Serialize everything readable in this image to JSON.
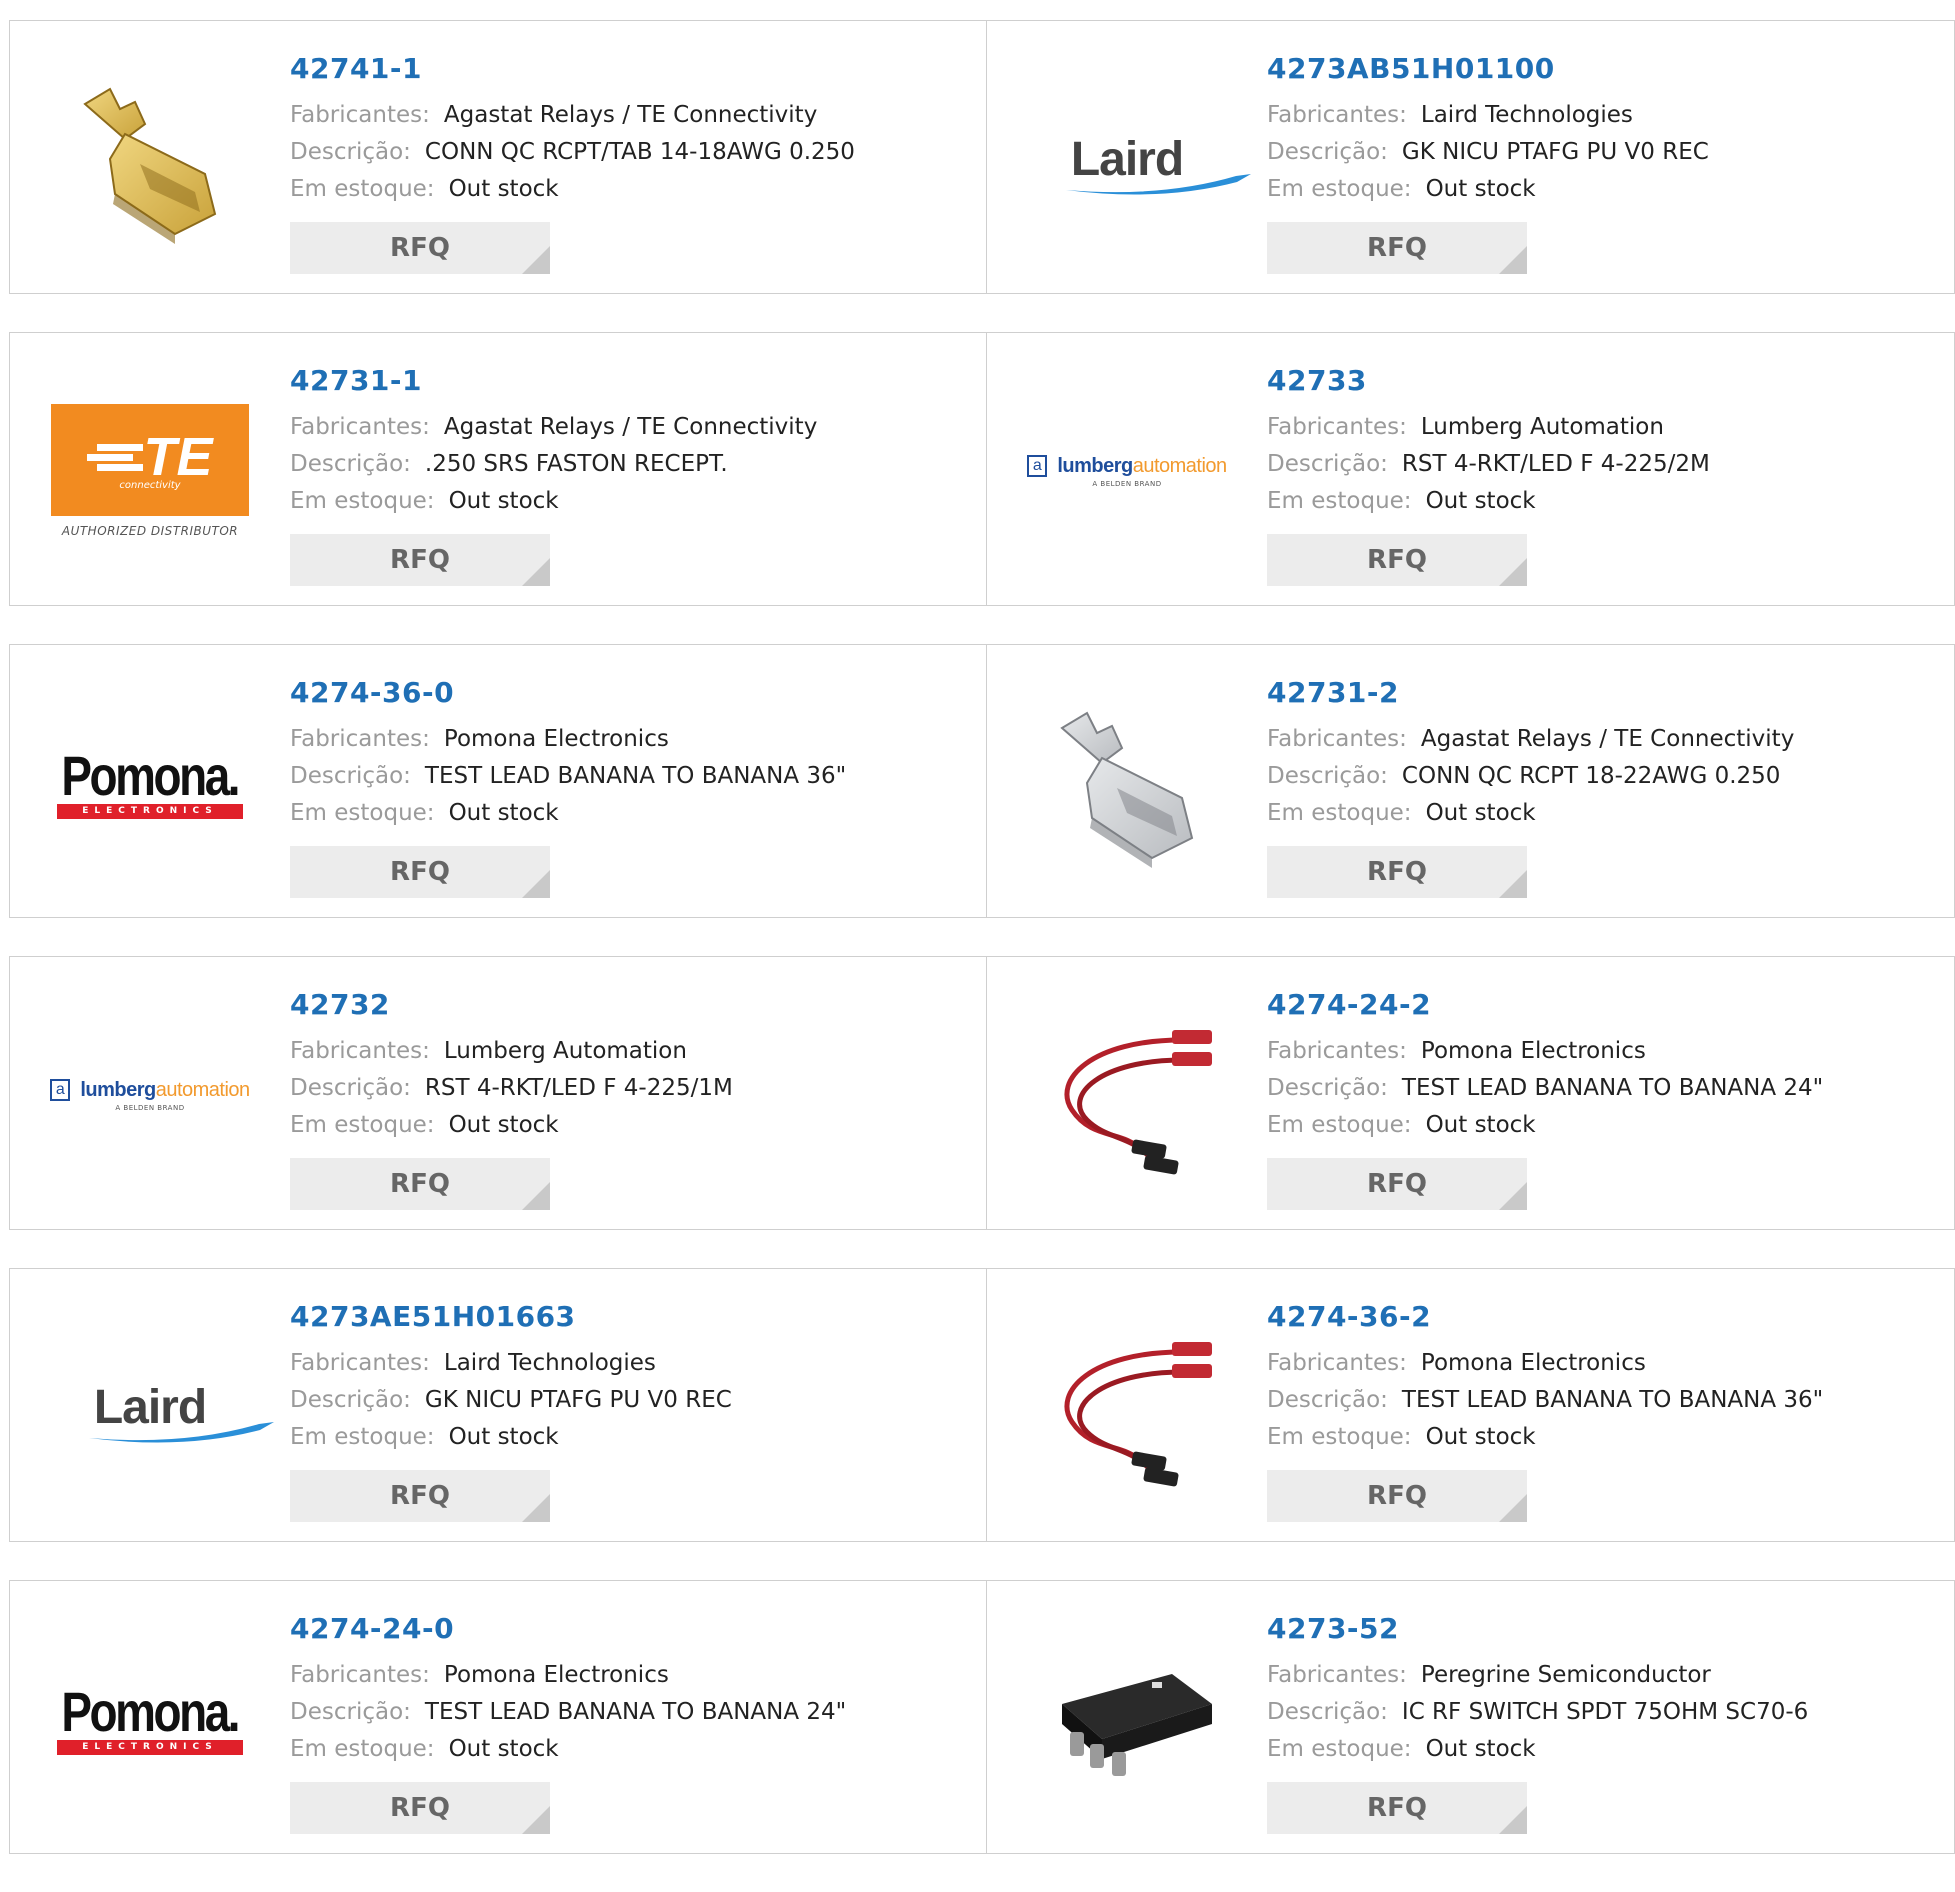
{
  "labels": {
    "manufacturer": "Fabricantes:",
    "description": "Descrição:",
    "stock": "Em estoque:",
    "rfq": "RFQ"
  },
  "products": [
    {
      "pn": "42741-1",
      "manufacturer": "Agastat Relays / TE Connectivity",
      "description": "CONN QC RCPT/TAB 14-18AWG 0.250",
      "stock": "Out stock",
      "image": "terminal-gold"
    },
    {
      "pn": "4273AB51H01100",
      "manufacturer": "Laird Technologies",
      "description": "GK NICU PTAFG PU V0 REC",
      "stock": "Out stock",
      "image": "laird-logo",
      "logo_text": "Laird"
    },
    {
      "pn": "42731-1",
      "manufacturer": "Agastat Relays / TE Connectivity",
      "description": ".250 SRS FASTON RECEPT.",
      "stock": "Out stock",
      "image": "te-logo",
      "logo_text": "TE",
      "logo_sub": "connectivity",
      "logo_tag": "AUTHORIZED DISTRIBUTOR"
    },
    {
      "pn": "42733",
      "manufacturer": "Lumberg Automation",
      "description": "RST 4-RKT/LED F 4-225/2M",
      "stock": "Out stock",
      "image": "lumberg-logo",
      "logo_text_a": "lumberg",
      "logo_text_b": "automation",
      "logo_tag": "A BELDEN BRAND"
    },
    {
      "pn": "4274-36-0",
      "manufacturer": "Pomona Electronics",
      "description": "TEST LEAD BANANA TO BANANA 36\"",
      "stock": "Out stock",
      "image": "pomona-logo",
      "logo_text": "Pomona.",
      "logo_tag": "ELECTRONICS"
    },
    {
      "pn": "42731-2",
      "manufacturer": "Agastat Relays / TE Connectivity",
      "description": "CONN QC RCPT 18-22AWG 0.250",
      "stock": "Out stock",
      "image": "terminal-silver"
    },
    {
      "pn": "42732",
      "manufacturer": "Lumberg Automation",
      "description": "RST 4-RKT/LED F 4-225/1M",
      "stock": "Out stock",
      "image": "lumberg-logo",
      "logo_text_a": "lumberg",
      "logo_text_b": "automation",
      "logo_tag": "A BELDEN BRAND"
    },
    {
      "pn": "4274-24-2",
      "manufacturer": "Pomona Electronics",
      "description": "TEST LEAD BANANA TO BANANA 24\"",
      "stock": "Out stock",
      "image": "test-lead-red"
    },
    {
      "pn": "4273AE51H01663",
      "manufacturer": "Laird Technologies",
      "description": "GK NICU PTAFG PU V0 REC",
      "stock": "Out stock",
      "image": "laird-logo",
      "logo_text": "Laird"
    },
    {
      "pn": "4274-36-2",
      "manufacturer": "Pomona Electronics",
      "description": "TEST LEAD BANANA TO BANANA 36\"",
      "stock": "Out stock",
      "image": "test-lead-red"
    },
    {
      "pn": "4274-24-0",
      "manufacturer": "Pomona Electronics",
      "description": "TEST LEAD BANANA TO BANANA 24\"",
      "stock": "Out stock",
      "image": "pomona-logo",
      "logo_text": "Pomona.",
      "logo_tag": "ELECTRONICS"
    },
    {
      "pn": "4273-52",
      "manufacturer": "Peregrine Semiconductor",
      "description": "IC RF SWITCH SPDT 75OHM SC70-6",
      "stock": "Out stock",
      "image": "ic-chip"
    }
  ],
  "colors": {
    "part_number": "#1f6fb5",
    "label": "#9a9a9a",
    "border": "#cfcfcf",
    "rfq_bg": "#ececec",
    "te_orange": "#f28b20",
    "pomona_red": "#e0202a",
    "laird_blue": "#2a8fd8"
  }
}
